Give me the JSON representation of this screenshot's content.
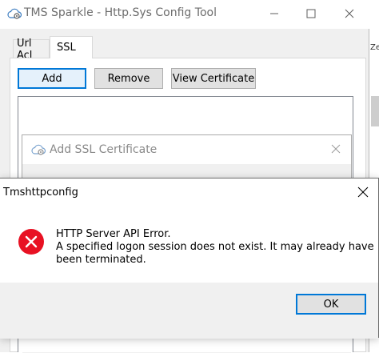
{
  "main_window": {
    "title": "TMS Sparkle - Http.Sys Config Tool",
    "icon": "cloud-gear-icon",
    "tabs": [
      {
        "label": "Url Acl",
        "selected": false
      },
      {
        "label": "SSL",
        "selected": true
      }
    ],
    "buttons": {
      "add": "Add",
      "remove": "Remove",
      "view_certificate": "View Certificate"
    }
  },
  "ssl_dialog": {
    "title": "Add SSL Certificate",
    "icon": "cloud-gear-icon"
  },
  "message_box": {
    "title": "Tmshttpconfig",
    "icon": "error-icon",
    "lines": [
      "HTTP Server API Error.",
      "A specified logon session does not exist. It may already have",
      "been terminated."
    ],
    "ok_label": "OK"
  },
  "background_window": {
    "text": "Ze"
  },
  "colors": {
    "accent": "#0078d7",
    "error": "#e81123",
    "window_bg": "#f0f0f0"
  }
}
